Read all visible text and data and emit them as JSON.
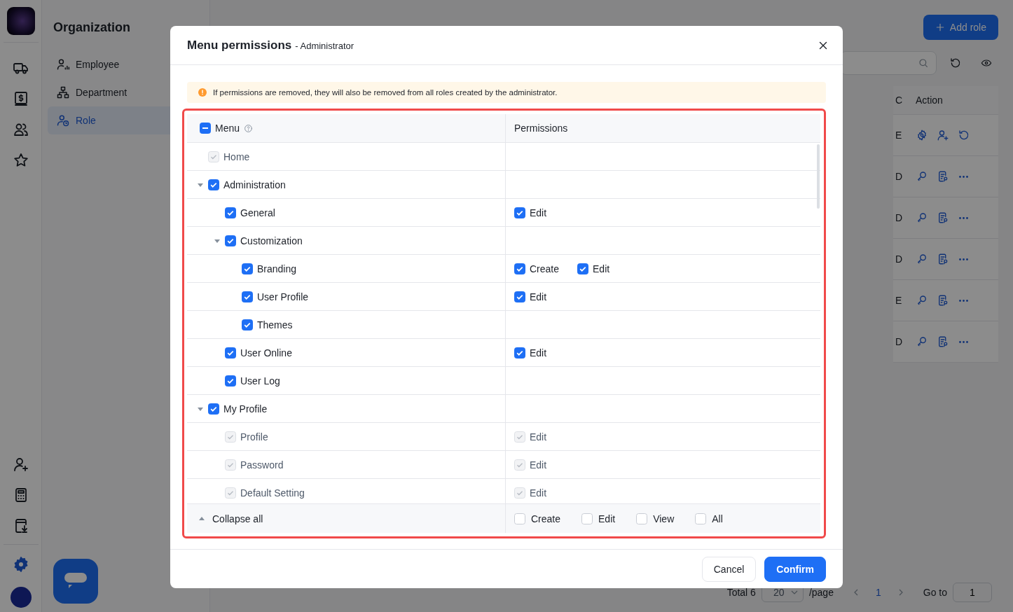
{
  "sidebar": {
    "title": "Organization",
    "items": [
      {
        "label": "Employee",
        "kind": "employee",
        "selected": false
      },
      {
        "label": "Department",
        "kind": "department",
        "selected": false
      },
      {
        "label": "Role",
        "kind": "role",
        "selected": true
      }
    ]
  },
  "toolbar": {
    "add_button": "Add role"
  },
  "table": {
    "columns": [
      "C",
      "Action"
    ],
    "rows": [
      {
        "column_1": "E",
        "kind": "owner"
      },
      {
        "column_1": "D",
        "kind": "normal"
      },
      {
        "column_1": "D",
        "kind": "normal"
      },
      {
        "column_1": "D",
        "kind": "normal"
      },
      {
        "column_1": "E",
        "kind": "normal"
      },
      {
        "column_1": "D",
        "kind": "normal"
      }
    ]
  },
  "pagination": {
    "total": "Total 6",
    "page_size": "20",
    "per_page": "/page",
    "current": "1",
    "goto_label": "Go to",
    "goto_value": "1"
  },
  "dialog": {
    "title": "Menu permissions",
    "subtitle": "- Administrator",
    "notice": "If permissions are removed, they will also be removed from all roles created by the administrator.",
    "menu_header": {
      "label": "Menu",
      "indeterminate": true
    },
    "permissions_header": "Permissions",
    "rows": [
      {
        "label": "Home",
        "checked": true,
        "disabled": true
      },
      {
        "label": "Administration",
        "checked": true,
        "disabled": false,
        "expanded": true,
        "children": [
          {
            "label": "General",
            "checked": true,
            "disabled": false,
            "permissions": [
              {
                "label": "Edit",
                "checked": true,
                "disabled": false
              }
            ]
          },
          {
            "label": "Customization",
            "checked": true,
            "disabled": false,
            "expanded": true,
            "children": [
              {
                "label": "Branding",
                "checked": true,
                "disabled": false,
                "permissions": [
                  {
                    "label": "Create",
                    "checked": true,
                    "disabled": false
                  },
                  {
                    "label": "Edit",
                    "checked": true,
                    "disabled": false
                  }
                ]
              },
              {
                "label": "User Profile",
                "checked": true,
                "disabled": false,
                "permissions": [
                  {
                    "label": "Edit",
                    "checked": true,
                    "disabled": false
                  }
                ]
              },
              {
                "label": "Themes",
                "checked": true,
                "disabled": false
              }
            ]
          },
          {
            "label": "User Online",
            "checked": true,
            "disabled": false,
            "permissions": [
              {
                "label": "Edit",
                "checked": true,
                "disabled": false
              }
            ]
          },
          {
            "label": "User Log",
            "checked": true,
            "disabled": false
          }
        ]
      },
      {
        "label": "My Profile",
        "checked": true,
        "disabled": false,
        "expanded": true,
        "children": [
          {
            "label": "Profile",
            "checked": true,
            "disabled": true,
            "permissions": [
              {
                "label": "Edit",
                "checked": true,
                "disabled": true
              }
            ]
          },
          {
            "label": "Password",
            "checked": true,
            "disabled": true,
            "permissions": [
              {
                "label": "Edit",
                "checked": true,
                "disabled": true
              }
            ]
          },
          {
            "label": "Default Setting",
            "checked": true,
            "disabled": true,
            "permissions": [
              {
                "label": "Edit",
                "checked": true,
                "disabled": true
              }
            ]
          }
        ]
      }
    ],
    "collapse_label": "Collapse all",
    "bulk_permissions": [
      {
        "label": "Create",
        "checked": false
      },
      {
        "label": "Edit",
        "checked": false
      },
      {
        "label": "View",
        "checked": false
      },
      {
        "label": "All",
        "checked": false
      }
    ],
    "buttons": [
      {
        "label": "Cancel",
        "kind": "secondary"
      },
      {
        "label": "Confirm",
        "kind": "primary"
      }
    ]
  }
}
